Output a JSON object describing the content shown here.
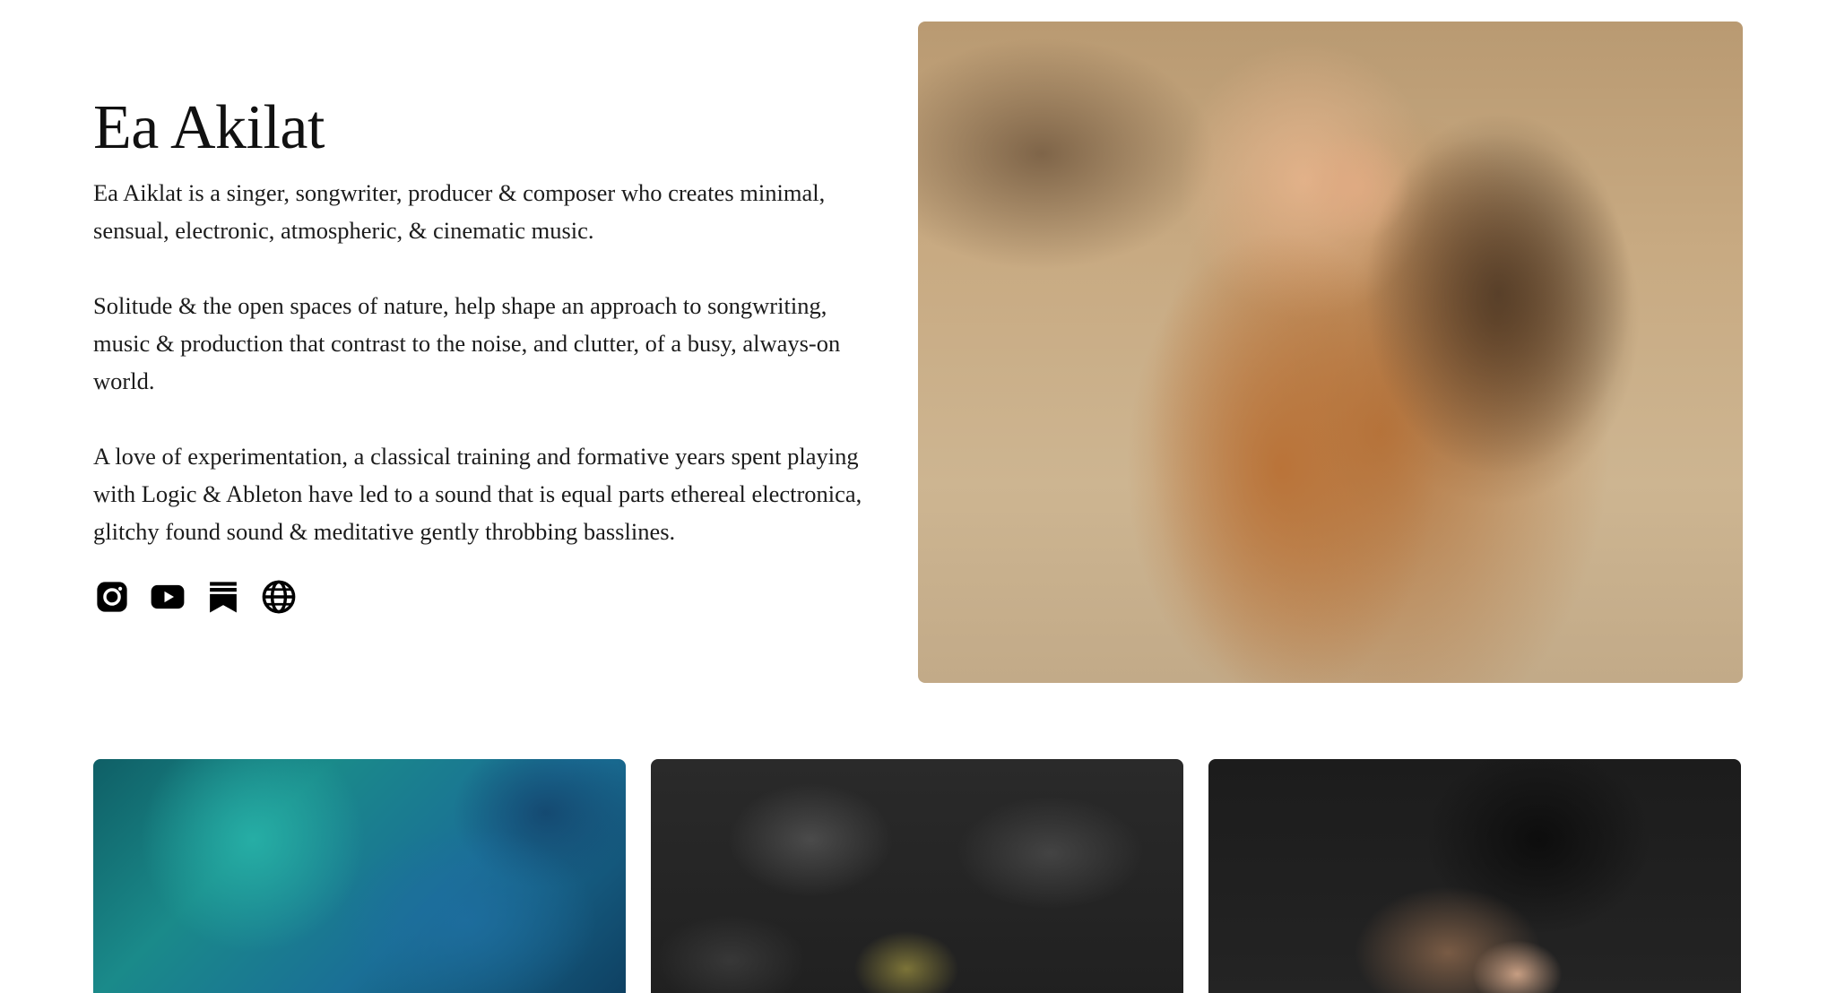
{
  "artist": {
    "name": "Ea Akilat"
  },
  "bio": {
    "paragraphs": [
      "Ea Aiklat is a singer, songwriter, producer & composer who creates minimal, sensual, electronic, atmospheric, & cinematic music.",
      "Solitude & the open spaces of nature, help shape an approach to songwriting, music & production that contrast to the noise, and clutter, of a busy, always-on world.",
      "A love of experimentation, a classical training and formative years spent playing with Logic & Ableton have led to a sound that is equal parts ethereal electronica, glitchy found sound & meditative gently throbbing basslines."
    ]
  },
  "social": {
    "links": [
      {
        "icon": "instagram-icon"
      },
      {
        "icon": "youtube-icon"
      },
      {
        "icon": "substack-icon"
      },
      {
        "icon": "globe-icon"
      }
    ]
  },
  "hero": {
    "image": "portrait-photo"
  },
  "gallery": {
    "tiles": [
      {
        "image": "aurora-photo"
      },
      {
        "image": "lava-rock-photo"
      },
      {
        "image": "dark-portrait-photo"
      }
    ]
  },
  "colors": {
    "text": "#1a1a1a",
    "background": "#ffffff",
    "icon": "#000000"
  }
}
